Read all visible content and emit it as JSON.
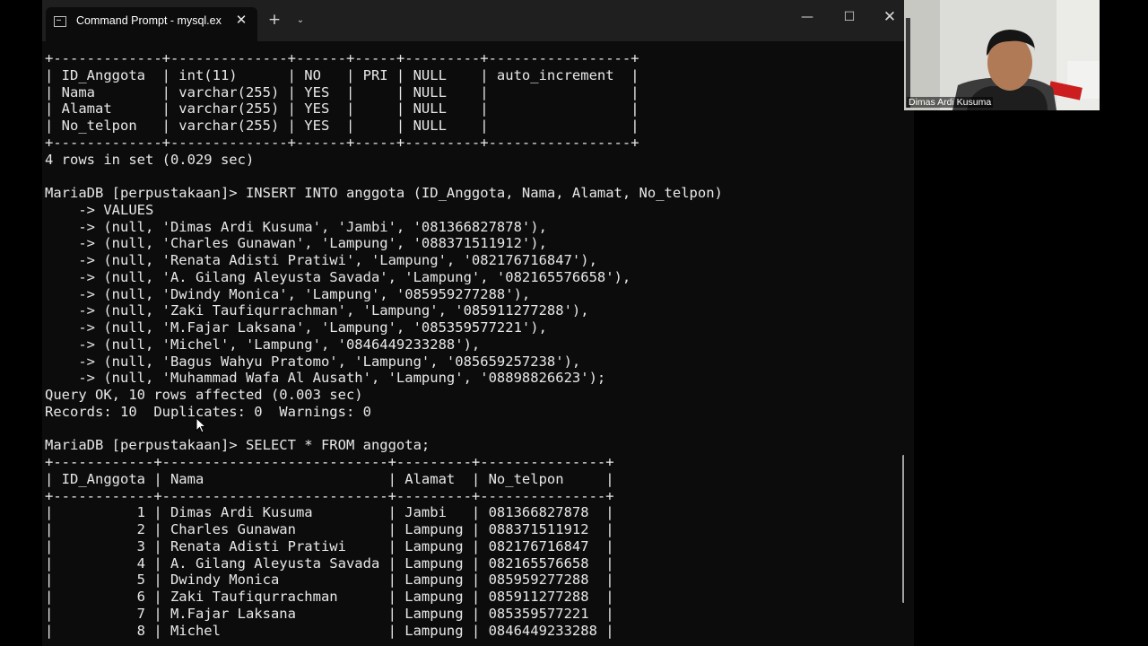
{
  "window": {
    "tab_title": "Command Prompt - mysql.exe",
    "icons": {
      "terminal": "terminal-icon",
      "close_tab": "close-icon",
      "new_tab": "plus-icon",
      "dropdown": "chevron-down-icon",
      "minimize": "minimize-icon",
      "maximize": "maximize-icon",
      "close": "close-icon"
    },
    "glyphs": {
      "close_tab": "✕",
      "new_tab": "+",
      "dropdown": "⌄",
      "minimize": "—",
      "maximize": "☐",
      "close": "✕"
    }
  },
  "terminal": {
    "lines": [
      "+-------------+--------------+------+-----+---------+-----------------+",
      "| ID_Anggota  | int(11)      | NO   | PRI | NULL    | auto_increment  |",
      "| Nama        | varchar(255) | YES  |     | NULL    |                 |",
      "| Alamat      | varchar(255) | YES  |     | NULL    |                 |",
      "| No_telpon   | varchar(255) | YES  |     | NULL    |                 |",
      "+-------------+--------------+------+-----+---------+-----------------+",
      "4 rows in set (0.029 sec)",
      "",
      "MariaDB [perpustakaan]> INSERT INTO anggota (ID_Anggota, Nama, Alamat, No_telpon)",
      "    -> VALUES",
      "    -> (null, 'Dimas Ardi Kusuma', 'Jambi', '081366827878'),",
      "    -> (null, 'Charles Gunawan', 'Lampung', '088371511912'),",
      "    -> (null, 'Renata Adisti Pratiwi', 'Lampung', '082176716847'),",
      "    -> (null, 'A. Gilang Aleyusta Savada', 'Lampung', '082165576658'),",
      "    -> (null, 'Dwindy Monica', 'Lampung', '085959277288'),",
      "    -> (null, 'Zaki Taufiqurrachman', 'Lampung', '085911277288'),",
      "    -> (null, 'M.Fajar Laksana', 'Lampung', '085359577221'),",
      "    -> (null, 'Michel', 'Lampung', '0846449233288'),",
      "    -> (null, 'Bagus Wahyu Pratomo', 'Lampung', '085659257238'),",
      "    -> (null, 'Muhammad Wafa Al Ausath', 'Lampung', '08898826623');",
      "Query OK, 10 rows affected (0.003 sec)",
      "Records: 10  Duplicates: 0  Warnings: 0",
      "",
      "MariaDB [perpustakaan]> SELECT * FROM anggota;",
      "+------------+---------------------------+---------+---------------+",
      "| ID_Anggota | Nama                      | Alamat  | No_telpon     |",
      "+------------+---------------------------+---------+---------------+",
      "|          1 | Dimas Ardi Kusuma         | Jambi   | 081366827878  |",
      "|          2 | Charles Gunawan           | Lampung | 088371511912  |",
      "|          3 | Renata Adisti Pratiwi     | Lampung | 082176716847  |",
      "|          4 | A. Gilang Aleyusta Savada | Lampung | 082165576658  |",
      "|          5 | Dwindy Monica             | Lampung | 085959277288  |",
      "|          6 | Zaki Taufiqurrachman      | Lampung | 085911277288  |",
      "|          7 | M.Fajar Laksana           | Lampung | 085359577221  |",
      "|          8 | Michel                    | Lampung | 0846449233288 |"
    ]
  },
  "webcam": {
    "name": "Dimas Ardi Kusuma"
  },
  "colors": {
    "terminal_bg": "#0c0c0c",
    "terminal_text": "#e8e8e8",
    "titlebar_bg": "#1f1f1f"
  }
}
